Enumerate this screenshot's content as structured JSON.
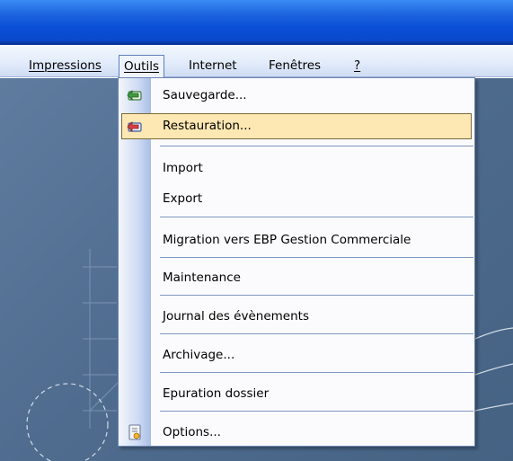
{
  "menubar": {
    "items": [
      {
        "label": "Impressions",
        "active": false
      },
      {
        "label": "Outils",
        "active": true
      },
      {
        "label": "Internet",
        "active": false
      },
      {
        "label": "Fenêtres",
        "active": false
      },
      {
        "label": "?",
        "active": false
      }
    ]
  },
  "outils_menu": {
    "items": [
      {
        "label": "Sauvegarde...",
        "icon": "backup-icon",
        "highlighted": false
      },
      {
        "label": "Restauration...",
        "icon": "restore-icon",
        "highlighted": true
      },
      {
        "label": "Import",
        "icon": null,
        "highlighted": false
      },
      {
        "label": "Export",
        "icon": null,
        "highlighted": false
      },
      {
        "label": "Migration vers EBP Gestion Commerciale",
        "icon": null,
        "highlighted": false
      },
      {
        "label": "Maintenance",
        "icon": null,
        "highlighted": false
      },
      {
        "label": "Journal des évènements",
        "icon": null,
        "highlighted": false
      },
      {
        "label": "Archivage...",
        "icon": null,
        "highlighted": false
      },
      {
        "label": "Epuration dossier",
        "icon": null,
        "highlighted": false
      },
      {
        "label": "Options...",
        "icon": "options-icon",
        "highlighted": false
      }
    ]
  },
  "colors": {
    "titlebar": "#0a4fd6",
    "highlight": "#fde7b3",
    "workspace": "#4f6c8f"
  }
}
